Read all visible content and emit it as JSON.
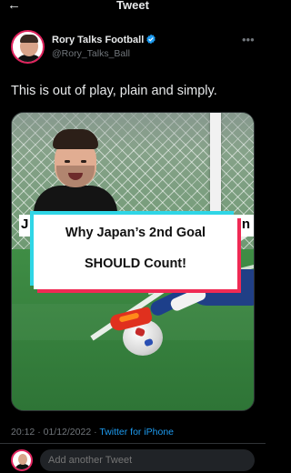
{
  "header": {
    "title": "Tweet",
    "back_icon": "back-arrow-icon"
  },
  "author": {
    "display_name": "Rory Talks Football",
    "handle": "@Rory_Talks_Ball",
    "verified": true,
    "verified_color": "#1d9bf0",
    "more_icon": "more-dots-icon"
  },
  "tweet": {
    "text": "This is out of play, plain and simply."
  },
  "media": {
    "caption_partial_left": "J",
    "caption_partial_right": "n",
    "caption_line1": "Why Japan’s 2nd Goal",
    "caption_line2": "SHOULD Count!"
  },
  "meta": {
    "time_date": "20:12 · 01/12/2022 · ",
    "source": "Twitter for iPhone"
  },
  "reply": {
    "placeholder": "Add another Tweet"
  },
  "colors": {
    "background": "#000000",
    "text": "#e7e9ea",
    "muted": "#71767b",
    "accent": "#1d9bf0",
    "caption_cyan": "#2fd6e6",
    "caption_red": "#f02a54"
  }
}
